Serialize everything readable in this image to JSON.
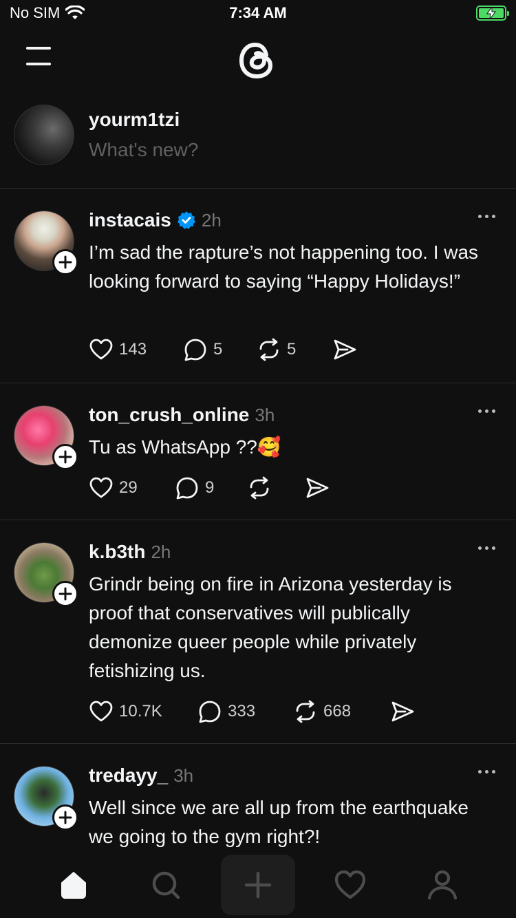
{
  "status_bar": {
    "carrier": "No SIM",
    "time": "7:34 AM"
  },
  "composer": {
    "username": "yourm1tzi",
    "placeholder": "What's new?"
  },
  "posts": [
    {
      "username": "instacais",
      "verified": true,
      "time": "2h",
      "text": "I’m sad the rapture’s not happening too. I was looking forward to saying “Happy Holidays!”",
      "likes": "143",
      "replies": "5",
      "reposts": "5"
    },
    {
      "username": "ton_crush_online",
      "verified": false,
      "time": "3h",
      "text": "Tu as WhatsApp ??🥰",
      "likes": "29",
      "replies": "9",
      "reposts": ""
    },
    {
      "username": "k.b3th",
      "verified": false,
      "time": "2h",
      "text": "Grindr being on fire in Arizona yesterday is proof that conservatives will publically demonize queer people while privately fetishizing us.",
      "likes": "10.7K",
      "replies": "333",
      "reposts": "668"
    },
    {
      "username": "tredayy_",
      "verified": false,
      "time": "3h",
      "text": "Well since we are all up from the earthquake we going to the gym right?!",
      "likes": "",
      "replies": "",
      "reposts": ""
    }
  ],
  "icons": {
    "menu": "menu-icon",
    "logo": "threads-logo-icon",
    "like": "heart-icon",
    "reply": "comment-icon",
    "repost": "repost-icon",
    "share": "send-icon",
    "more": "more-icon",
    "verified": "verified-badge-icon",
    "tabs": [
      "home-icon",
      "search-icon",
      "plus-icon",
      "heart-icon",
      "profile-icon"
    ]
  },
  "colors": {
    "background": "#101010",
    "text": "#f3f5f7",
    "secondary": "#777777",
    "verified": "#0095f6",
    "battery": "#4cd964"
  }
}
